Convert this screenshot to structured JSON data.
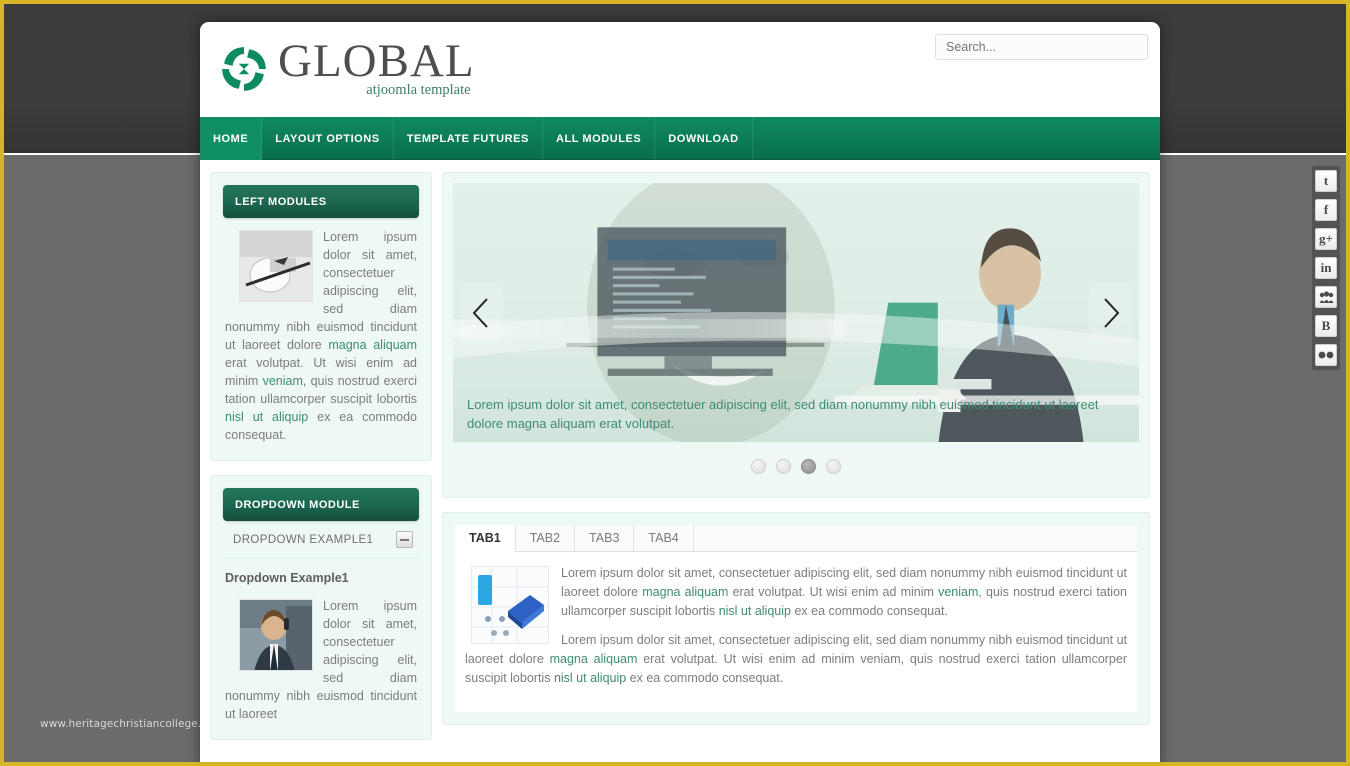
{
  "page": {
    "watermark": "www.heritagechristiancollege.com",
    "accent_green": "#0d7f58",
    "panel_bg": "#eef8f5",
    "border_gold": "#d8b427"
  },
  "header": {
    "brand_name": "GLOBAL",
    "tagline": "atjoomla template",
    "logo_icon": "spiral-logo-icon",
    "search": {
      "placeholder": "Search...",
      "value": ""
    }
  },
  "nav": {
    "items": [
      {
        "label": "HOME",
        "active": true
      },
      {
        "label": "LAYOUT OPTIONS",
        "active": false
      },
      {
        "label": "TEMPLATE FUTURES",
        "active": false
      },
      {
        "label": "ALL MODULES",
        "active": false
      },
      {
        "label": "DOWNLOAD",
        "active": false
      }
    ]
  },
  "left_column": {
    "left_module": {
      "title": "LEFT MODULES",
      "thumb_icon": "printer-photo",
      "text_1": "Lorem ipsum dolor sit amet, consectetuer adipiscing elit, sed diam nonummy nibh euismod tincidunt ut laoreet dolore ",
      "link_1": "magna aliquam",
      "text_2": " erat volutpat. Ut wisi enim ad minim ",
      "link_2": "veniam",
      "text_3": ", quis nostrud exerci tation ullamcorper suscipit lobortis ",
      "link_3": "nisl ut aliquip",
      "text_4": " ex ea commodo consequat."
    },
    "dropdown_module": {
      "title": "DROPDOWN MODULE",
      "row_label": "DROPDOWN EXAMPLE1",
      "toggle_icon": "minus-box-icon",
      "sub_title": "Dropdown Example1",
      "thumb_icon": "businessman-phone-photo",
      "text_1": "Lorem ipsum dolor sit amet, consectetuer adipiscing elit, sed diam nonummy nibh euismod tincidunt ut laoreet"
    }
  },
  "slider": {
    "image_alt": "businessman-with-laptop-photo",
    "prev_icon": "chevron-left-icon",
    "next_icon": "chevron-right-icon",
    "caption": "Lorem ipsum dolor sit amet, consectetuer adipiscing elit, sed diam nonummy nibh euismod tincidunt ut laoreet dolore magna aliquam erat volutpat.",
    "dots": [
      {
        "active": false
      },
      {
        "active": false
      },
      {
        "active": true
      },
      {
        "active": false
      }
    ]
  },
  "tabs": {
    "items": [
      {
        "label": "TAB1",
        "active": true
      },
      {
        "label": "TAB2",
        "active": false
      },
      {
        "label": "TAB3",
        "active": false
      },
      {
        "label": "TAB4",
        "active": false
      }
    ],
    "content": {
      "thumb_icon": "blue-device-illustration",
      "p1_a": "Lorem ipsum dolor sit amet, consectetuer adipiscing elit, sed diam nonummy nibh euismod tincidunt ut laoreet dolore ",
      "p1_link1": "magna aliquam",
      "p1_b": " erat volutpat. Ut wisi enim ad minim ",
      "p1_link2": "veniam",
      "p1_c": ", quis nostrud exerci tation ullamcorper suscipit lobortis ",
      "p1_link3": "nisl ut aliquip",
      "p1_d": " ex ea commodo consequat.",
      "p2_a": "Lorem ipsum dolor sit amet, consectetuer adipiscing elit, sed diam nonummy nibh euismod tincidunt ut laoreet dolore ",
      "p2_link1": "magna aliquam",
      "p2_b": " erat volutpat. Ut wisi enim ad minim veniam, quis nostrud exerci tation ullamcorper suscipit lobortis ",
      "p2_link2": "nisl ut aliquip",
      "p2_c": " ex ea commodo consequat."
    }
  },
  "social_rail": {
    "items": [
      {
        "name": "tumblr-icon",
        "glyph": "t"
      },
      {
        "name": "facebook-icon",
        "glyph": "f"
      },
      {
        "name": "google-plus-icon",
        "glyph": "g+"
      },
      {
        "name": "linkedin-icon",
        "glyph": "in"
      },
      {
        "name": "myspace-icon",
        "glyph": "☸"
      },
      {
        "name": "blogger-icon",
        "glyph": "B"
      },
      {
        "name": "flickr-icon",
        "glyph": "••"
      }
    ]
  }
}
